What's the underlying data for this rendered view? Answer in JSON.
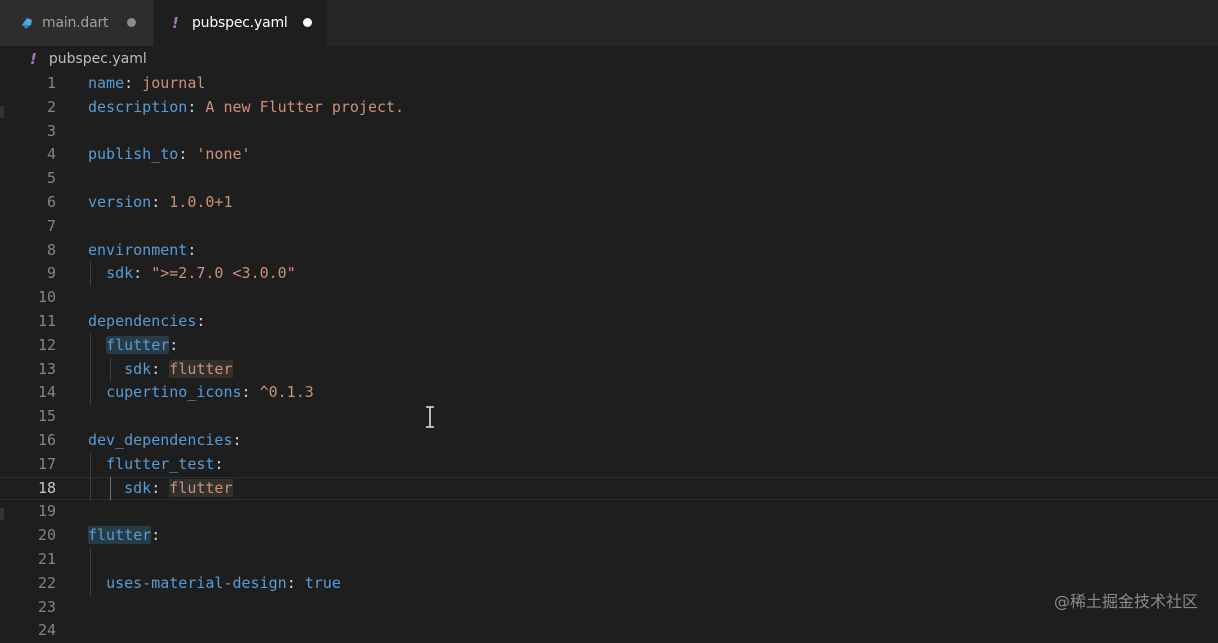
{
  "tabs": [
    {
      "label": "main.dart",
      "icon": "dart-icon",
      "dirty": true
    },
    {
      "label": "pubspec.yaml",
      "icon": "yaml-exclamation-icon",
      "dirty": true,
      "active": true
    }
  ],
  "breadcrumb": {
    "icon": "!",
    "label": "pubspec.yaml"
  },
  "yaml_icon_glyph": "!",
  "lines": [
    {
      "n": "1",
      "tokens": [
        [
          "key",
          "name"
        ],
        [
          "punc",
          ": "
        ],
        [
          "str",
          "journal"
        ]
      ]
    },
    {
      "n": "2",
      "tokens": [
        [
          "key",
          "description"
        ],
        [
          "punc",
          ": "
        ],
        [
          "str",
          "A new Flutter project."
        ]
      ]
    },
    {
      "n": "3",
      "tokens": []
    },
    {
      "n": "4",
      "tokens": [
        [
          "key",
          "publish_to"
        ],
        [
          "punc",
          ": "
        ],
        [
          "str",
          "'none'"
        ]
      ]
    },
    {
      "n": "5",
      "tokens": []
    },
    {
      "n": "6",
      "tokens": [
        [
          "key",
          "version"
        ],
        [
          "punc",
          ": "
        ],
        [
          "str",
          "1.0.0+1"
        ]
      ]
    },
    {
      "n": "7",
      "tokens": []
    },
    {
      "n": "8",
      "tokens": [
        [
          "key",
          "environment"
        ],
        [
          "punc",
          ":"
        ]
      ]
    },
    {
      "n": "9",
      "tokens": [
        [
          "punc",
          "  "
        ],
        [
          "key",
          "sdk"
        ],
        [
          "punc",
          ": "
        ],
        [
          "str",
          "\">=2.7.0 <3.0.0\""
        ]
      ]
    },
    {
      "n": "10",
      "tokens": []
    },
    {
      "n": "11",
      "tokens": [
        [
          "key",
          "dependencies"
        ],
        [
          "punc",
          ":"
        ]
      ]
    },
    {
      "n": "12",
      "tokens": [
        [
          "punc",
          "  "
        ],
        [
          "key hl",
          "flutter"
        ],
        [
          "punc",
          ":"
        ]
      ]
    },
    {
      "n": "13",
      "tokens": [
        [
          "punc",
          "    "
        ],
        [
          "key",
          "sdk"
        ],
        [
          "punc",
          ": "
        ],
        [
          "str hl2",
          "flutter"
        ]
      ]
    },
    {
      "n": "14",
      "tokens": [
        [
          "punc",
          "  "
        ],
        [
          "key",
          "cupertino_icons"
        ],
        [
          "punc",
          ": "
        ],
        [
          "str",
          "^0.1.3"
        ]
      ]
    },
    {
      "n": "15",
      "tokens": []
    },
    {
      "n": "16",
      "tokens": [
        [
          "key",
          "dev_dependencies"
        ],
        [
          "punc",
          ":"
        ]
      ]
    },
    {
      "n": "17",
      "tokens": [
        [
          "punc",
          "  "
        ],
        [
          "key",
          "flutter_test"
        ],
        [
          "punc",
          ":"
        ]
      ]
    },
    {
      "n": "18",
      "tokens": [
        [
          "punc",
          "    "
        ],
        [
          "key",
          "sdk"
        ],
        [
          "punc",
          ": "
        ],
        [
          "str hl2",
          "flutter"
        ]
      ],
      "current": true
    },
    {
      "n": "19",
      "tokens": []
    },
    {
      "n": "20",
      "tokens": [
        [
          "key hl",
          "flutter"
        ],
        [
          "punc",
          ":"
        ]
      ]
    },
    {
      "n": "21",
      "tokens": []
    },
    {
      "n": "22",
      "tokens": [
        [
          "punc",
          "  "
        ],
        [
          "key",
          "uses-material-design"
        ],
        [
          "punc",
          ": "
        ],
        [
          "bool",
          "true"
        ]
      ]
    },
    {
      "n": "23",
      "tokens": []
    },
    {
      "n": "24",
      "tokens": []
    }
  ],
  "watermark": "@稀土掘金技术社区"
}
